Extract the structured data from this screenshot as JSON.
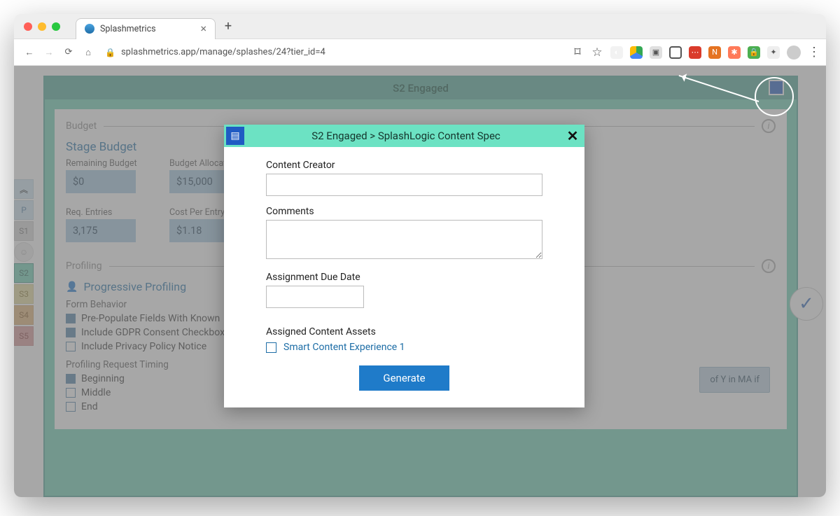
{
  "browser": {
    "tab_title": "Splashmetrics",
    "url_display": "splashmetrics.app/manage/splashes/24?tier_id=4"
  },
  "sidenav": {
    "items": [
      "P",
      "S1",
      "",
      "S2",
      "S3",
      "S4",
      "S5"
    ]
  },
  "stage": {
    "title": "S2 Engaged",
    "budget_section": "Budget",
    "stage_budget_title": "Stage Budget",
    "remaining_label": "Remaining Budget",
    "remaining_value": "$0",
    "alloc_label": "Budget Allocation",
    "alloc_value": "$15,000",
    "req_label": "Req. Entries",
    "req_value": "3,175",
    "cpe_label": "Cost Per Entry",
    "cpe_value": "$1.18",
    "profiling_section": "Profiling",
    "progressive_title": "Progressive Profiling",
    "form_behavior_label": "Form Behavior",
    "fb1": "Pre-Populate Fields With Known",
    "fb2": "Include GDPR Consent Checkbox",
    "fb3": "Include Privacy Policy Notice",
    "timing_label": "Profiling Request Timing",
    "t1": "Beginning",
    "t2": "Middle",
    "t3": "End",
    "right_snippet": "of Y in MA if"
  },
  "modal": {
    "title": "S2 Engaged > SplashLogic Content Spec",
    "creator_label": "Content Creator",
    "comments_label": "Comments",
    "due_label": "Assignment Due Date",
    "assets_label": "Assigned Content Assets",
    "asset1": "Smart Content Experience 1",
    "generate": "Generate"
  }
}
